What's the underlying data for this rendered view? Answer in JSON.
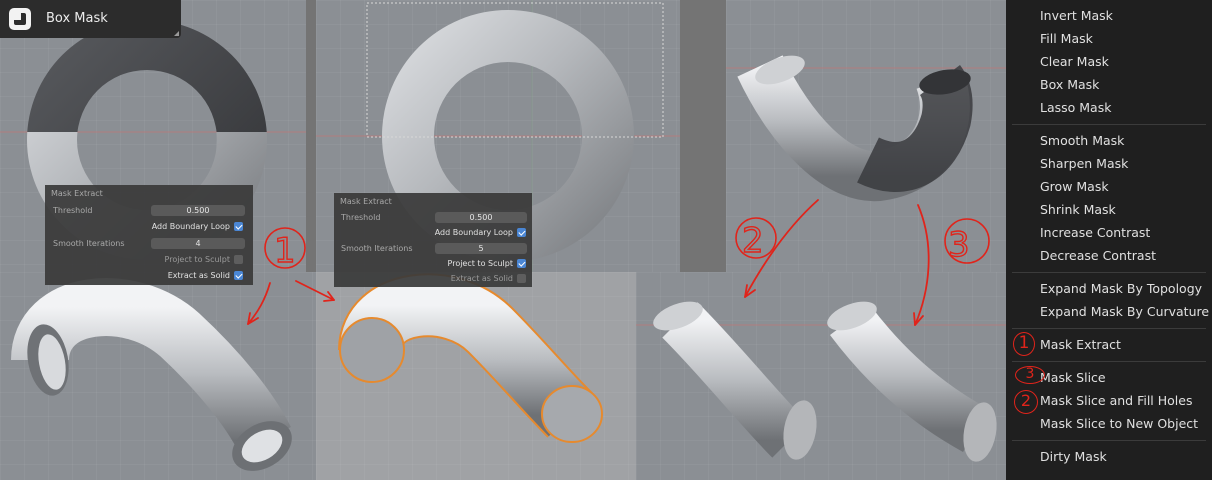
{
  "header": {
    "title": "Box Mask",
    "icon": "box-mask-tool-icon"
  },
  "popup_1": {
    "title": "Mask Extract",
    "threshold_label": "Threshold",
    "threshold_value": "0.500",
    "add_boundary_loop_label": "Add Boundary Loop",
    "add_boundary_loop_checked": true,
    "smooth_iterations_label": "Smooth Iterations",
    "smooth_iterations_value": "4",
    "project_to_sculpt_label": "Project to Sculpt",
    "project_to_sculpt_checked": false,
    "extract_as_solid_label": "Extract as Solid",
    "extract_as_solid_checked": true
  },
  "popup_2": {
    "title": "Mask Extract",
    "threshold_label": "Threshold",
    "threshold_value": "0.500",
    "add_boundary_loop_label": "Add Boundary Loop",
    "add_boundary_loop_checked": true,
    "smooth_iterations_label": "Smooth Iterations",
    "smooth_iterations_value": "5",
    "project_to_sculpt_label": "Project to Sculpt",
    "project_to_sculpt_checked": true,
    "extract_as_solid_label": "Extract as Solid",
    "extract_as_solid_checked": false
  },
  "annotations": {
    "one": "1",
    "two": "2",
    "three": "3",
    "color": "#e0241b"
  },
  "menu": {
    "items": [
      "Invert Mask",
      "Fill Mask",
      "Clear Mask",
      "Box Mask",
      "Lasso Mask",
      "Smooth Mask",
      "Sharpen Mask",
      "Grow Mask",
      "Shrink Mask",
      "Increase Contrast",
      "Decrease Contrast",
      "Expand Mask By Topology",
      "Expand Mask By Curvature",
      "Mask Extract",
      "Mask Slice",
      "Mask Slice and Fill Holes",
      "Mask Slice to New Object",
      "Dirty Mask"
    ],
    "markers": {
      "mask_extract": "1",
      "mask_slice": "3",
      "mask_slice_fill_holes": "2"
    }
  }
}
